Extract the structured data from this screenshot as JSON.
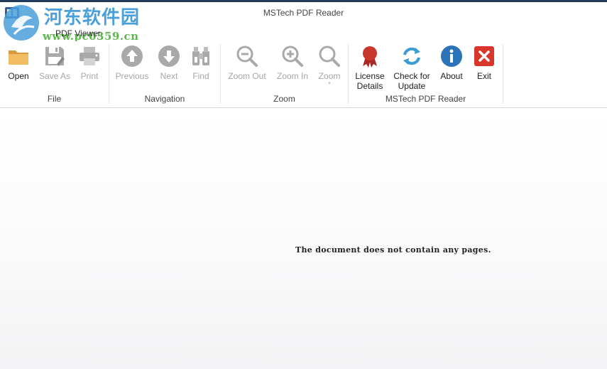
{
  "window": {
    "title": "MSTech PDF Reader"
  },
  "watermark": {
    "text": "河东软件园",
    "url": "www.pc0359.cn"
  },
  "tabs": {
    "active": "PDF Viewer"
  },
  "ribbon": {
    "file": {
      "label": "File",
      "open": "Open",
      "save_as": "Save As",
      "print": "Print"
    },
    "navigation": {
      "label": "Navigation",
      "previous": "Previous",
      "next": "Next",
      "find": "Find"
    },
    "zoom": {
      "label": "Zoom",
      "zoom_out": "Zoom Out",
      "zoom_in": "Zoom In",
      "zoom": "Zoom",
      "zoom_arrow": "▾"
    },
    "app": {
      "label": "MSTech PDF Reader",
      "license_line1": "License",
      "license_line2": "Details",
      "update_line1": "Check for",
      "update_line2": "Update",
      "about": "About",
      "exit": "Exit"
    }
  },
  "document": {
    "empty_message": "The document does not contain any pages."
  },
  "colors": {
    "folder": "#e9b457",
    "disabled_icon": "#a9a9a9",
    "license": "#c9372c",
    "update": "#3b9bd3",
    "about": "#2a73b8",
    "exit": "#d9362b",
    "watermark_blue": "#4a9fd8",
    "watermark_green": "#5bb84a"
  }
}
